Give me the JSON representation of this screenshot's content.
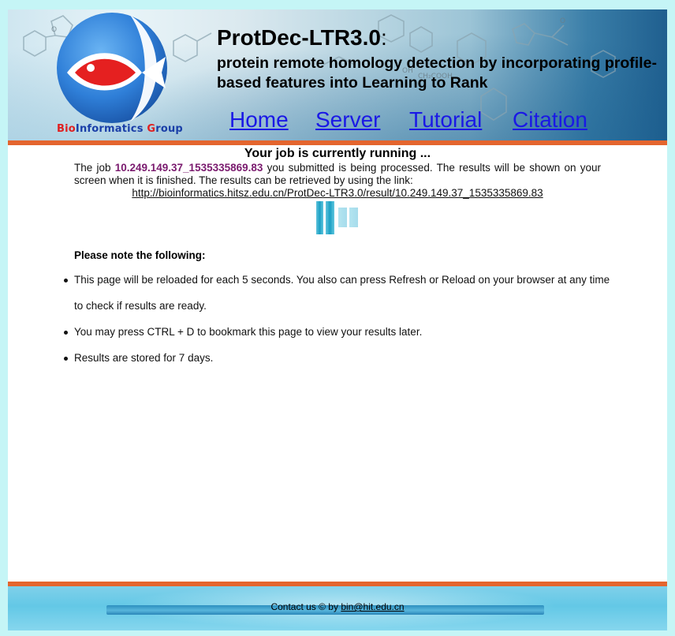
{
  "header": {
    "group_name_red": "Bio",
    "group_name_blue1": "Informatics ",
    "group_name_red2": "G",
    "group_name_blue2": "roup",
    "title": "ProtDec-LTR3.0",
    "title_colon": ":",
    "subtitle": "protein remote homology detection by incorporating profile-based features into Learning to Rank"
  },
  "nav": {
    "home": "Home",
    "server": "Server",
    "tutorial": "Tutorial",
    "citation": "Citation"
  },
  "main": {
    "running_title": "Your job is currently running ...",
    "job_prefix": "The job ",
    "job_id": "10.249.149.37_1535335869.83",
    "job_suffix": " you submitted is being processed. The results will be shown on your screen when it is finished. The results can be retrieved by using the link:",
    "result_link": "http://bioinformatics.hitsz.edu.cn/ProtDec-LTR3.0/result/10.249.149.37_1535335869.83",
    "note_heading": "Please note the following:",
    "notes": [
      "This page will be reloaded for each 5 seconds. You also can press Refresh or Reload on your browser at any time to check if results are ready.",
      "You may press CTRL + D to bookmark this page to view your results later.",
      "Results are stored for 7 days."
    ]
  },
  "footer": {
    "contact_prefix": "Contact us © by ",
    "email": "bin@hit.edu.cn"
  },
  "colors": {
    "accent_orange": "#e4652e",
    "nav_link": "#1a18e6",
    "job_id": "#7a1a6e",
    "page_bg": "#c5f5f6"
  }
}
